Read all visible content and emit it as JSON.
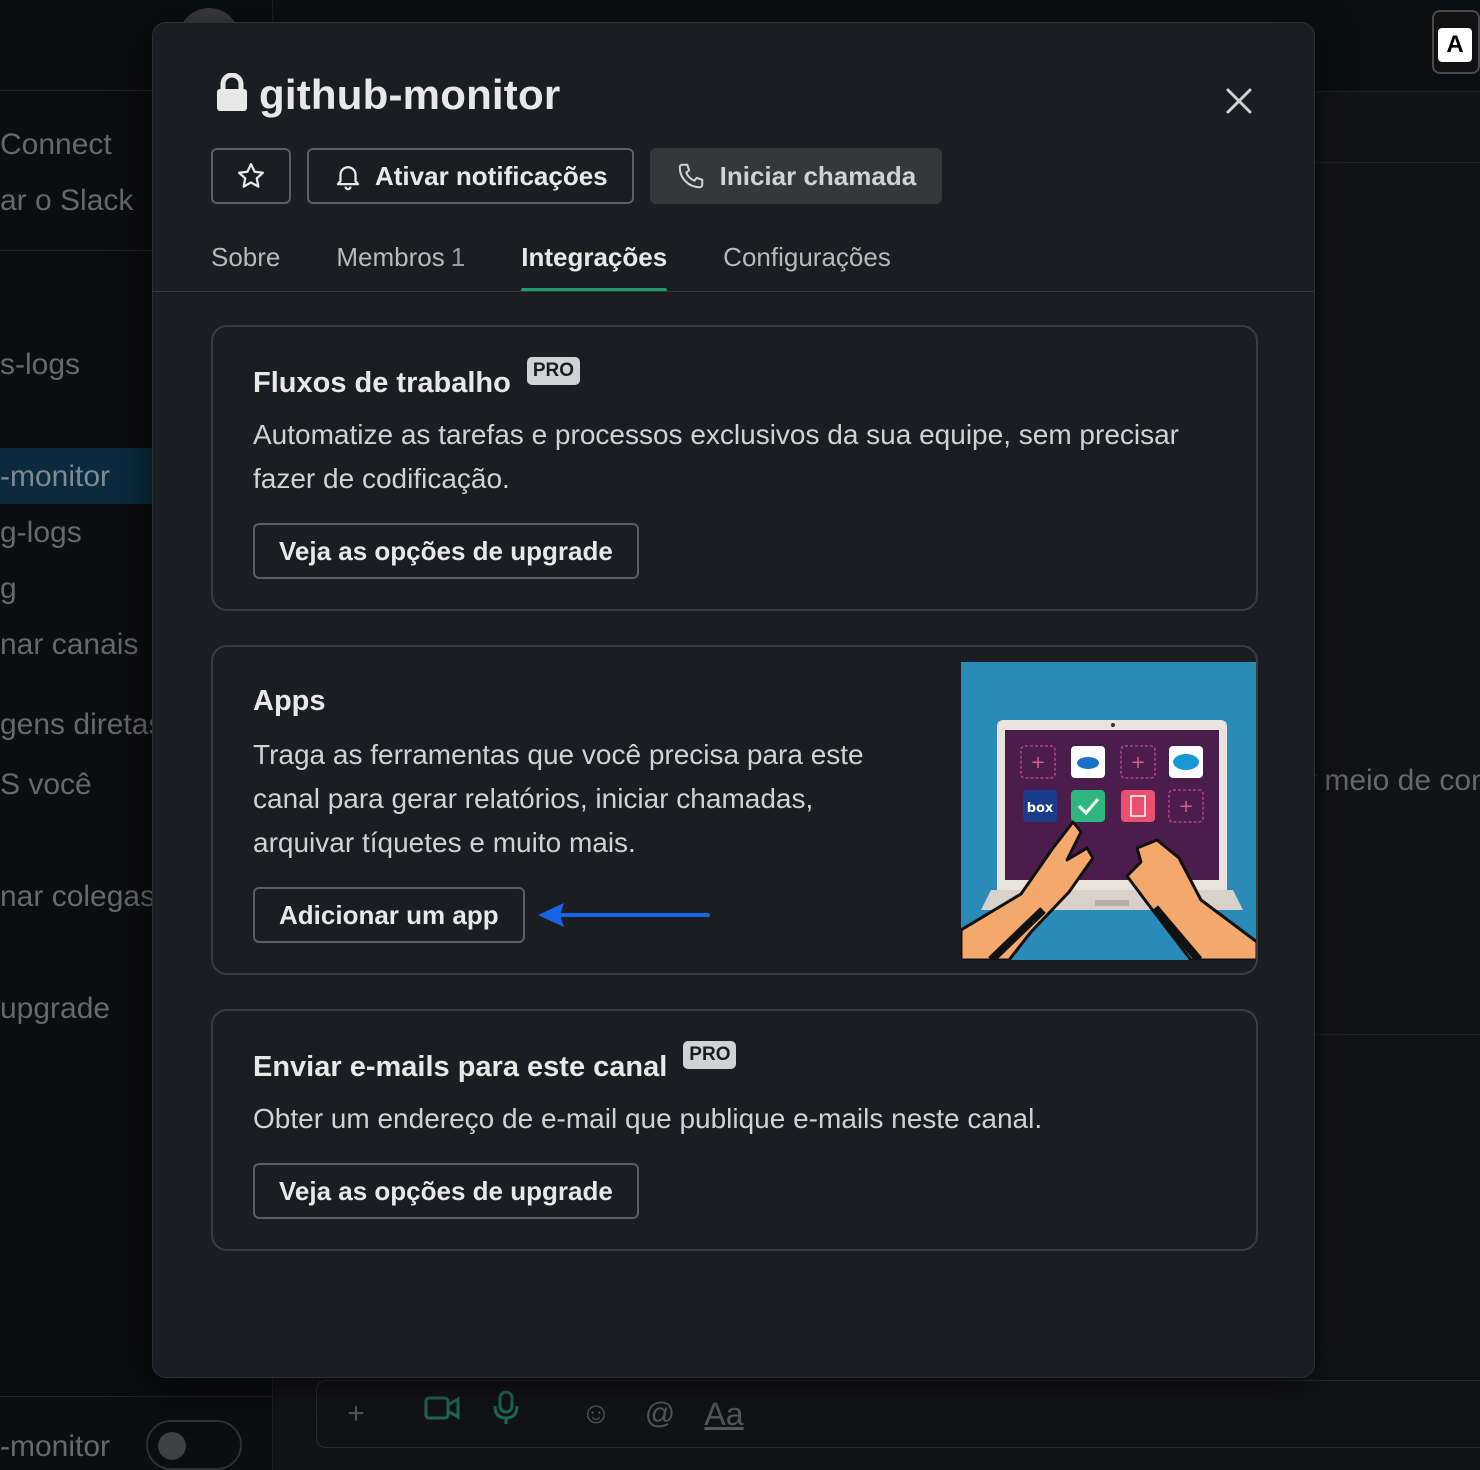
{
  "background": {
    "sidebar_items": [
      "Connect",
      "ar o Slack",
      "s-logs",
      "-monitor",
      "g-logs",
      "g",
      "nar canais",
      "gens diretas",
      "S  você",
      "nar colegas",
      "upgrade"
    ],
    "footer_channel": "-monitor",
    "main_partial_text": "r meio de con"
  },
  "modal": {
    "title": "github-monitor",
    "buttons": {
      "notifications": "Ativar notificações",
      "call": "Iniciar chamada"
    },
    "tabs": [
      {
        "label": "Sobre"
      },
      {
        "label": "Membros",
        "count": "1"
      },
      {
        "label": "Integrações",
        "active": true
      },
      {
        "label": "Configurações"
      }
    ],
    "cards": {
      "workflows": {
        "title": "Fluxos de trabalho",
        "badge": "PRO",
        "description": "Automatize as tarefas e processos exclusivos da sua equipe, sem precisar fazer de codificação.",
        "button": "Veja as opções de upgrade"
      },
      "apps": {
        "title": "Apps",
        "description": "Traga as ferramentas que você precisa para este canal para gerar relatórios, iniciar chamadas, arquivar tíquetes e muito mais.",
        "button": "Adicionar um app"
      },
      "email": {
        "title": "Enviar e-mails para este canal",
        "badge": "PRO",
        "description": "Obter um endereço de e-mail que publique e-mails neste canal.",
        "button": "Veja as opções de upgrade"
      }
    }
  },
  "colors": {
    "modal_bg": "#1a1d21",
    "tab_underline": "#1f9a6c",
    "annotation_arrow": "#1565e6",
    "illustration_bg": "#2a8bb8",
    "laptop_screen": "#4a1d4d"
  }
}
